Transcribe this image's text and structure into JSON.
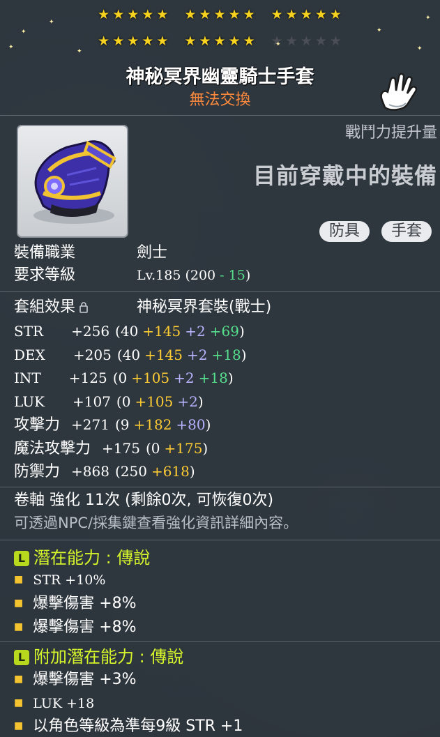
{
  "stars": {
    "row1": [
      5,
      5,
      5
    ],
    "row2_filled": [
      5,
      5,
      0
    ],
    "row2_empty": [
      0,
      0,
      5
    ],
    "glyph": "★"
  },
  "item": {
    "name": "神秘冥界幽靈騎士手套",
    "trade": "無法交換",
    "icon": "purple-gauntlet-icon",
    "slot_icon": "white-glove-icon"
  },
  "header": {
    "power_up": "戰鬥力提升量",
    "equipped": "目前穿戴中的裝備",
    "categories": [
      "防具",
      "手套"
    ]
  },
  "info": {
    "job_label": "裝備職業",
    "job_value": "劍士",
    "level_label": "要求等級",
    "level_prefix": "Lv.185 (200 ",
    "level_reduction": "- 15",
    "level_suffix": ")",
    "set_label": "套組效果",
    "set_value": "神秘冥界套裝(戰士)"
  },
  "stats": [
    {
      "name": "STR",
      "total": "+256",
      "base": "(40",
      "a": "+145",
      "b": "+2",
      "c": "+69",
      "end": ")"
    },
    {
      "name": "DEX",
      "total": "+205",
      "base": "(40",
      "a": "+145",
      "b": "+2",
      "c": "+18",
      "end": ")"
    },
    {
      "name": "INT",
      "total": "+125",
      "base": "(0",
      "a": "+105",
      "b": "+2",
      "c": "+18",
      "end": ")"
    },
    {
      "name": "LUK",
      "total": "+107",
      "base": "(0",
      "a": "+105",
      "b": "+2",
      "c": "",
      "end": ")"
    },
    {
      "name": "攻擊力",
      "total": "+271",
      "base": "(9",
      "a": "+182",
      "b": "+80",
      "c": "",
      "end": ")"
    },
    {
      "name": "魔法攻擊力",
      "total": "+175",
      "base": "(0",
      "a": "+175",
      "b": "",
      "c": "",
      "end": ")"
    },
    {
      "name": "防禦力",
      "total": "+868",
      "base": "(250",
      "a": "+618",
      "b": "",
      "c": "",
      "end": ")"
    }
  ],
  "scroll": {
    "line": "卷軸 強化 11次 (剩餘0次, 可恢復0次)",
    "hint": "可透過NPC/採集鍵查看強化資訊詳細內容。"
  },
  "potential": {
    "badge": "L",
    "title": "潛在能力 : 傳說",
    "lines": [
      "STR +10%",
      "爆擊傷害 +8%",
      "爆擊傷害 +8%"
    ]
  },
  "bonus_potential": {
    "badge": "L",
    "title": "附加潛在能力 : 傳說",
    "lines": [
      "爆擊傷害 +3%",
      "LUK +18",
      "以角色等級為準每9級 STR +1"
    ]
  },
  "colors": {
    "name": "#ffffff",
    "trade": "#ff8a3c",
    "upgrade_yellow": "#ffcc33",
    "upgrade_purple": "#b7b3ff",
    "upgrade_green": "#56e08c",
    "legendary": "#d6f52a"
  }
}
